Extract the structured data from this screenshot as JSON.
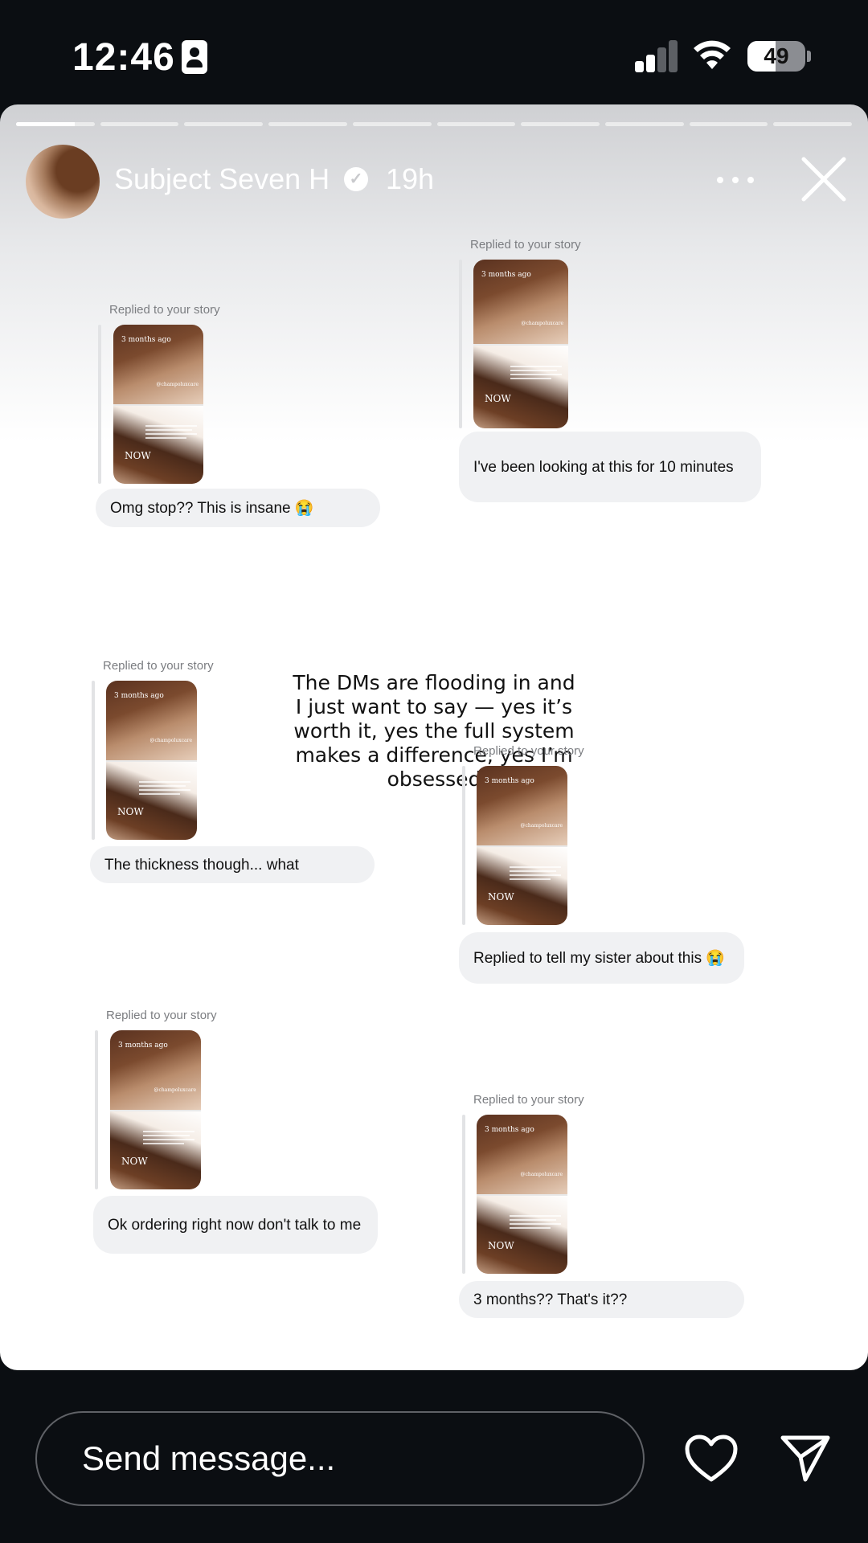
{
  "status_bar": {
    "time": "12:46",
    "battery_percent": "49",
    "battery_level": 0.49,
    "signal_bars": 2,
    "icons": [
      "id-card-icon",
      "cellular-signal-icon",
      "wifi-icon",
      "battery-icon"
    ]
  },
  "story": {
    "progress_segments": 10,
    "active_segment": 0,
    "active_segment_progress": 0.75,
    "username": "Subject Seven H",
    "verified": true,
    "time_ago": "19h",
    "caption": "The DMs are flooding in and I just want to say — yes it’s worth it, yes the full system makes a difference, yes I’m obsessed",
    "thumbnail": {
      "top_text": "3 months ago",
      "watermark": "@champoluxcare",
      "bottom_text": "NOW"
    },
    "replies": [
      {
        "label": "Replied to your story",
        "message": "Omg stop?? This is insane 😭"
      },
      {
        "label": "Replied to your story",
        "message": "I've been looking at this for 10 minutes"
      },
      {
        "label": "Replied to your story",
        "message": "The thickness though... what"
      },
      {
        "label": "Replied to your story",
        "message": "Replied to tell my sister about this 😭"
      },
      {
        "label": "Replied to your story",
        "message": "Ok ordering right now don't talk to me"
      },
      {
        "label": "Replied to your story",
        "message": "3 months?? That's it??"
      }
    ]
  },
  "bottom_bar": {
    "message_placeholder": "Send message...",
    "icons": [
      "heart-icon",
      "send-icon"
    ]
  },
  "colors": {
    "background": "#0b0e12",
    "bubble": "#f0f1f3",
    "label": "#7b7d81"
  }
}
